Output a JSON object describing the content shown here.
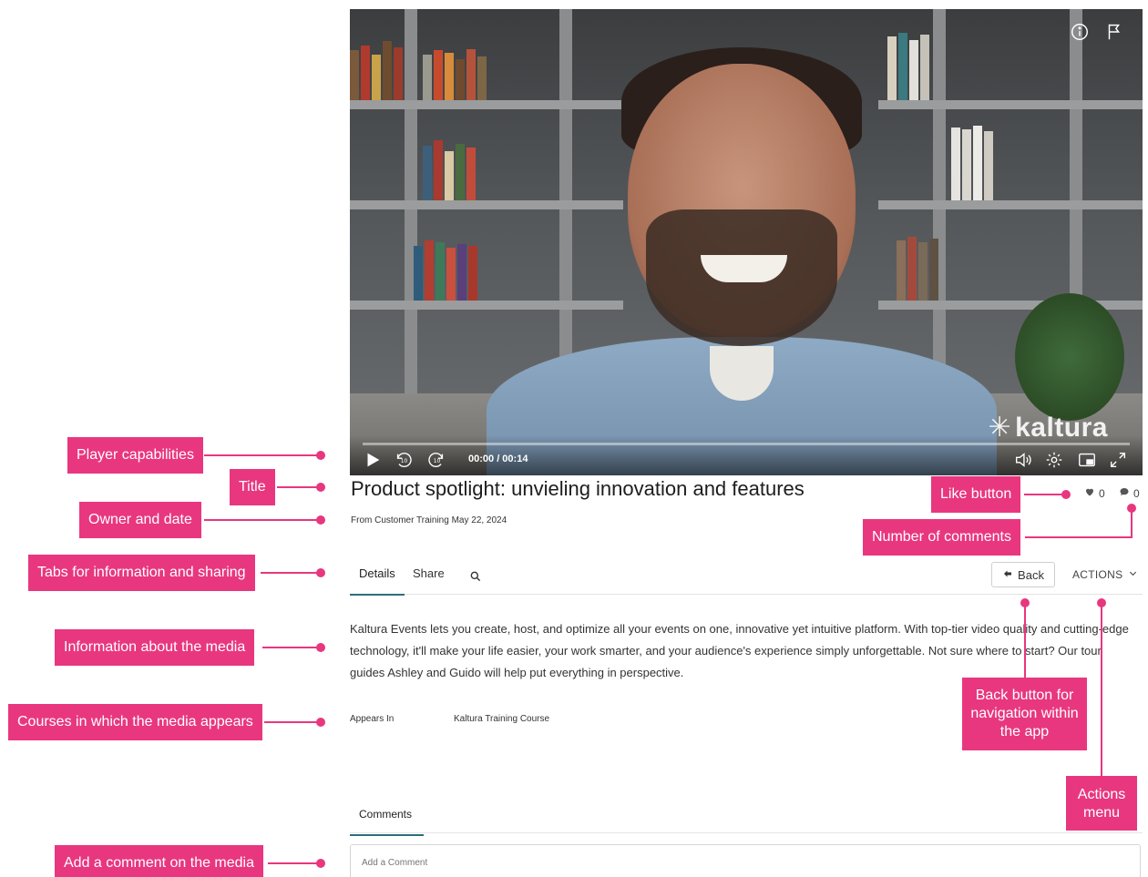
{
  "player": {
    "time": "00:00 / 00:14",
    "brand": "kaltura",
    "icons": [
      "info-icon",
      "flag-icon",
      "play-icon",
      "rewind-10-icon",
      "forward-10-icon",
      "volume-icon",
      "settings-icon",
      "pip-icon",
      "fullscreen-icon"
    ]
  },
  "media": {
    "title": "Product spotlight: unvieling innovation and features",
    "owner_line": "From Customer Training May 22, 2024",
    "likes": "0",
    "comments": "0",
    "description": "Kaltura Events lets you create, host, and optimize all your events on one, innovative yet intuitive platform. With top-tier video quality and cutting-edge technology, it'll make your life easier, your work smarter, and your audience's experience simply unforgettable. Not sure where to start? Our tour guides Ashley and Guido will help put everything in perspective.",
    "appears_in_label": "Appears In",
    "appears_in_value": "Kaltura Training Course"
  },
  "tabs": {
    "details": "Details",
    "share": "Share",
    "back": "Back",
    "actions": "ACTIONS"
  },
  "comments": {
    "tab": "Comments",
    "placeholder": "Add a Comment"
  },
  "callouts": {
    "player": "Player capabilities",
    "title": "Title",
    "owner": "Owner and date",
    "tabs": "Tabs for information and sharing",
    "info": "Information about the media",
    "courses": "Courses in which the media appears",
    "add_comment": "Add a comment on the media",
    "like": "Like button",
    "num_comments": "Number of comments",
    "back": "Back button for navigation within the app",
    "actions": "Actions menu"
  },
  "colors": {
    "callout": "#e8377f",
    "tab_underline": "#2b6f7a"
  }
}
